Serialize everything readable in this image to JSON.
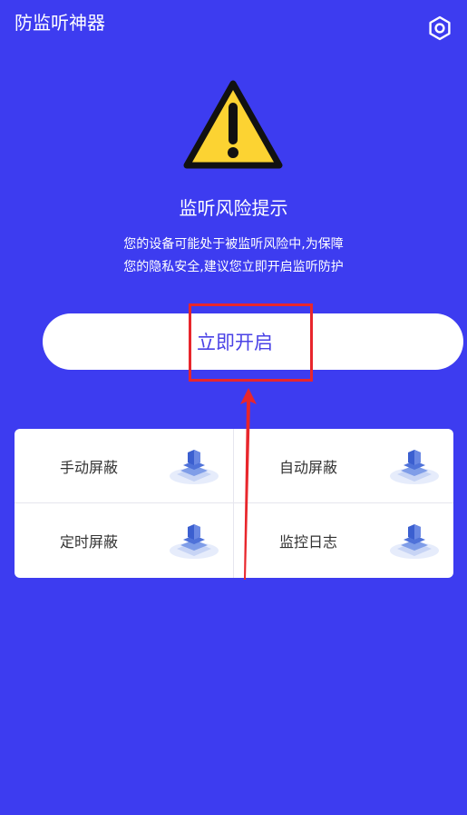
{
  "app": {
    "title": "防监听神器"
  },
  "colors": {
    "background": "#3d3cf0",
    "accent": "#4a42e6",
    "highlight": "#e8262c",
    "warning": "#fcd332"
  },
  "icons": {
    "settings": "hexagon-settings-icon",
    "warning": "warning-triangle-icon",
    "feature": "shield-stack-icon"
  },
  "risk": {
    "title": "监听风险提示",
    "desc_line1": "您的设备可能处于被监听风险中,为保障",
    "desc_line2": "您的隐私安全,建议您立即开启监听防护"
  },
  "enable_button": {
    "label": "立即开启"
  },
  "features": [
    {
      "label": "手动屏蔽"
    },
    {
      "label": "自动屏蔽"
    },
    {
      "label": "定时屏蔽"
    },
    {
      "label": "监控日志"
    }
  ]
}
